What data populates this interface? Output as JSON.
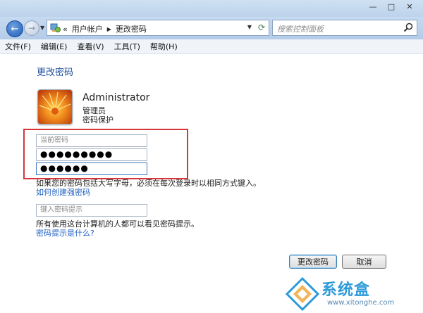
{
  "address": {
    "crumbs": [
      "用户帐户",
      "更改密码"
    ],
    "overflow": "«"
  },
  "search": {
    "placeholder": "搜索控制面板"
  },
  "menu": [
    "文件(F)",
    "编辑(E)",
    "查看(V)",
    "工具(T)",
    "帮助(H)"
  ],
  "page": {
    "heading": "更改密码"
  },
  "user": {
    "name": "Administrator",
    "role": "管理员",
    "status": "密码保护"
  },
  "fields": {
    "current_password_placeholder": "当前密码",
    "new_password_value": "●●●●●●●●●",
    "confirm_password_value": "●●●●●●",
    "hint_placeholder": "键入密码提示"
  },
  "notes": {
    "case_note": "如果您的密码包括大写字母，必须在每次登录时以相同方式键入。",
    "strong_link": "如何创建强密码",
    "hint_note": "所有使用这台计算机的人都可以看见密码提示。",
    "hint_link": "密码提示是什么?"
  },
  "buttons": {
    "change": "更改密码",
    "cancel": "取消"
  },
  "watermark": {
    "text": "系统盒",
    "url": "www.xitonghe.com"
  },
  "colors": {
    "heading": "#1e4f9c",
    "link": "#1f5fc1",
    "highlight": "#d6363a",
    "watermark": "#2d9ad8"
  }
}
